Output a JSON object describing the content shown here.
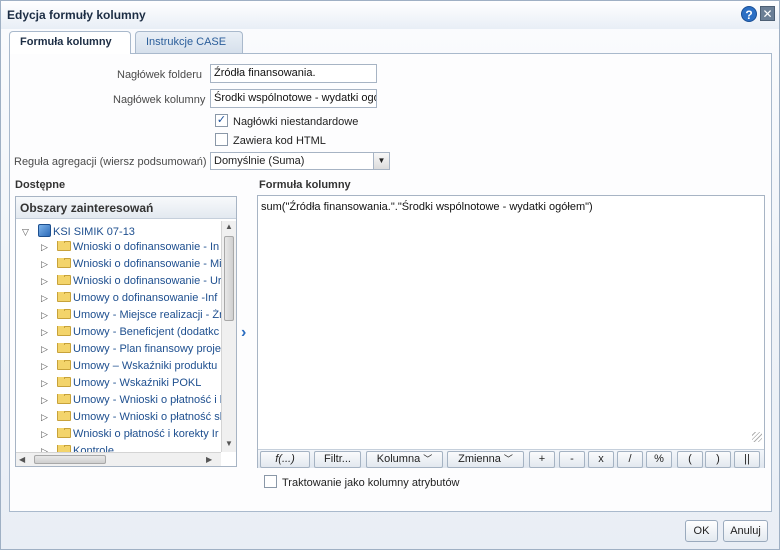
{
  "dialog": {
    "title": "Edycja formuły kolumny",
    "help_icon": "question-mark-icon",
    "close_icon": "close-x-icon"
  },
  "tabs": [
    {
      "label": "Formuła kolumny",
      "active": true
    },
    {
      "label": "Instrukcje CASE",
      "active": false
    }
  ],
  "form": {
    "folder_header_label": "Nagłówek folderu",
    "folder_header_value": "Źródła finansowania.",
    "column_header_label": "Nagłówek kolumny",
    "column_header_value": "Środki wspólnotowe - wydatki ogó",
    "custom_headers_label": "Nagłówki niestandardowe",
    "custom_headers_checked": true,
    "contains_html_label": "Zawiera kod HTML",
    "contains_html_checked": false,
    "aggregation_label": "Reguła agregacji (wiersz podsumowań)",
    "aggregation_value": "Domyślnie (Suma)"
  },
  "available": {
    "heading": "Dostępne",
    "tree_header": "Obszary zainteresowań",
    "root": {
      "label": "KSI SIMIK 07-13",
      "icon": "subject-area-cube-icon"
    },
    "items": [
      "Wnioski o dofinansowanie - In",
      "Wnioski o dofinansowanie - Mi",
      "Wnioski o dofinansowanie - Ur",
      "Umowy o dofinansowanie -Inf",
      "Umowy - Miejsce realizacji - Źr",
      "Umowy - Beneficjent (dodatkc",
      "Umowy - Plan finansowy proje",
      "Umowy – Wskaźniki produktu i",
      "Umowy - Wskaźniki POKL",
      "Umowy - Wnioski o płatność i l",
      "Umowy - Wnioski o płatność sl",
      "Wnioski o płatność i korekty Ir",
      "Kontrole"
    ]
  },
  "formula": {
    "heading": "Formuła kolumny",
    "text": "sum(\"Źródła finansowania.\".\"Środki wspólnotowe - wydatki ogółem\")",
    "toolbar": {
      "function": "f(...)",
      "filter": "Filtr...",
      "column": "Kolumna",
      "variable": "Zmienna",
      "plus": "+",
      "minus": "-",
      "multiply": "x",
      "divide": "/",
      "percent": "%",
      "open_paren": "(",
      "close_paren": ")",
      "concat": "||"
    }
  },
  "attribute_columns": {
    "label": "Traktowanie jako kolumny atrybutów",
    "checked": false
  },
  "buttons": {
    "ok": "OK",
    "cancel": "Anuluj"
  }
}
